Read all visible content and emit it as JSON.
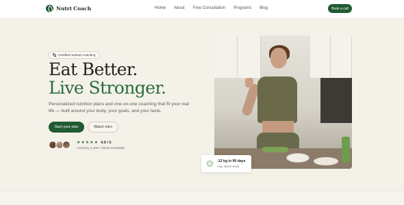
{
  "brand": {
    "name": "Nutri Coach"
  },
  "nav": {
    "links": [
      "Home",
      "About",
      "Free Consultation",
      "Programs",
      "Blog"
    ],
    "active": "Home",
    "cta": "Book a call"
  },
  "hero": {
    "badge": "Certified nutrition coaching",
    "headline_line1": "Eat Better.",
    "headline_line2": "Live Stronger.",
    "description": "Personalized nutrition plans and one-on-one coaching that fit your real life — built around your body, your goals, and your taste.",
    "primary_cta": "Start your plan",
    "secondary_cta": "Watch intro",
    "rating": "4.9 / 5",
    "rating_stars": 5,
    "social_proof": "Loved by 2,400+ clients worldwide"
  },
  "result_card": {
    "title": "-12 kg in 90 days",
    "subtitle": "Avg. client result"
  },
  "colors": {
    "brand_green": "#1f5a32",
    "accent_green": "#2a6b3c",
    "background": "#f3f1e8"
  }
}
